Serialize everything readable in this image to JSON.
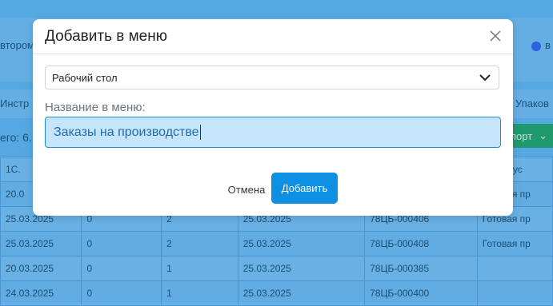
{
  "background": {
    "toolbar_text_left": "втором",
    "toolbar_text_right": "в",
    "tab_left": "Инстр",
    "tab_right": "Упаков",
    "total_label": "его: 6.",
    "export_button": "порт",
    "table_rows": [
      [
        "1С.",
        "",
        "",
        "",
        "",
        "ип выпус"
      ],
      [
        "20.0",
        "",
        "",
        "",
        "",
        "Готовая пр"
      ],
      [
        "25.03.2025",
        "0",
        "2",
        "25.03.2025",
        "78ЦБ-000406",
        "Готовая пр"
      ],
      [
        "25.03.2025",
        "0",
        "2",
        "25.03.2025",
        "78ЦБ-000408",
        "Готовая пр"
      ],
      [
        "20.03.2025",
        "0",
        "1",
        "25.03.2025",
        "78ЦБ-000385",
        ""
      ],
      [
        "24.03.2025",
        "0",
        "1",
        "25.03.2025",
        "78ЦБ-000400",
        ""
      ]
    ]
  },
  "modal": {
    "title": "Добавить в меню",
    "close_icon": "close-icon",
    "select_value": "Рабочий стол",
    "field_label": "Название в меню:",
    "name_value": "Заказы на производстве",
    "cancel_label": "Отмена",
    "add_label": "Добавить"
  },
  "colors": {
    "primary": "#0d8fe3",
    "input_focus_bg": "#c7e5fa",
    "input_border": "#1c8fd0",
    "backdrop": "#5aaee8"
  }
}
